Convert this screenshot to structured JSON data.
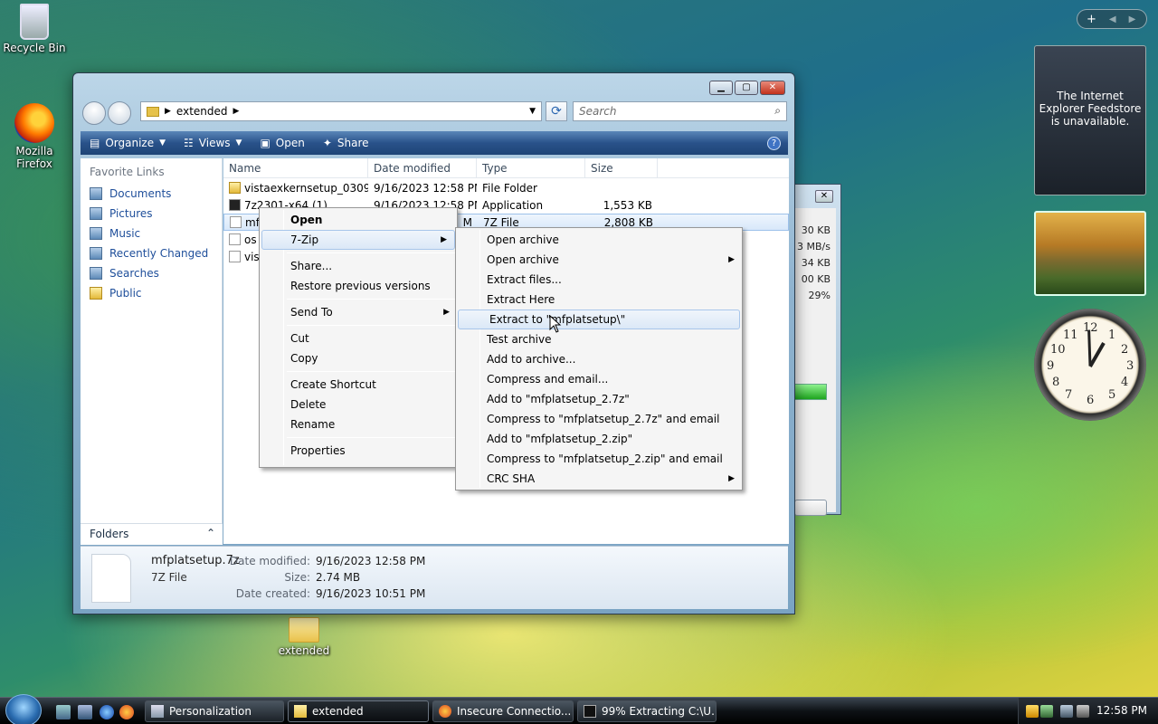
{
  "desktop": {
    "recycle_bin": "Recycle Bin",
    "firefox_line1": "Mozilla",
    "firefox_line2": "Firefox",
    "extended_folder": "extended"
  },
  "explorer": {
    "address": "extended",
    "search_placeholder": "Search",
    "toolbar": {
      "organize": "Organize",
      "views": "Views",
      "open": "Open",
      "share": "Share",
      "help": "?"
    },
    "nav": {
      "header": "Favorite Links",
      "links": [
        "Documents",
        "Pictures",
        "Music",
        "Recently Changed",
        "Searches",
        "Public"
      ],
      "folders": "Folders"
    },
    "columns": [
      "Name",
      "Date modified",
      "Type",
      "Size"
    ],
    "rows": [
      {
        "name": "vistaexkernsetup_0309...",
        "date": "9/16/2023 12:58 PM",
        "type": "File Folder",
        "size": ""
      },
      {
        "name": "7z2301-x64 (1)",
        "date": "9/16/2023 12:58 PM",
        "type": "Application",
        "size": "1,553 KB"
      },
      {
        "name": "mf",
        "date": "M",
        "type": "7Z File",
        "size": "2,808 KB"
      },
      {
        "name": "os",
        "date": "",
        "type": "",
        "size": ""
      },
      {
        "name": "vis",
        "date": "",
        "type": "",
        "size": ""
      }
    ],
    "details": {
      "filename": "mfplatsetup.7z",
      "filetype": "7Z File",
      "date_modified_label": "Date modified:",
      "date_modified": "9/16/2023 12:58 PM",
      "size_label": "Size:",
      "size": "2.74 MB",
      "date_created_label": "Date created:",
      "date_created": "9/16/2023 10:51 PM"
    }
  },
  "progress_window": {
    "values": [
      "30 KB",
      "3 MB/s",
      "34 KB",
      "00 KB",
      "29%"
    ],
    "percent": 29
  },
  "context_menu": {
    "items": [
      "Open",
      "7-Zip",
      "Share...",
      "Restore previous versions",
      "Send To",
      "Cut",
      "Copy",
      "Create Shortcut",
      "Delete",
      "Rename",
      "Properties"
    ]
  },
  "zip_menu": {
    "items": [
      "Open archive",
      "Open archive",
      "Extract files...",
      "Extract Here",
      "Extract to \"mfplatsetup\\\"",
      "Test archive",
      "Add to archive...",
      "Compress and email...",
      "Add to \"mfplatsetup_2.7z\"",
      "Compress to \"mfplatsetup_2.7z\" and email",
      "Add to \"mfplatsetup_2.zip\"",
      "Compress to \"mfplatsetup_2.zip\" and email",
      "CRC SHA"
    ]
  },
  "gadgets": {
    "feed_message": "The Internet Explorer Feedstore is unavailable.",
    "sidebar_add": "+",
    "clock_numbers": [
      "12",
      "1",
      "2",
      "3",
      "4",
      "5",
      "6",
      "7",
      "8",
      "9",
      "10",
      "11"
    ]
  },
  "taskbar": {
    "buttons": [
      "Personalization",
      "extended",
      "Insecure Connectio...",
      "99% Extracting C:\\U..."
    ],
    "time": "12:58 PM"
  }
}
